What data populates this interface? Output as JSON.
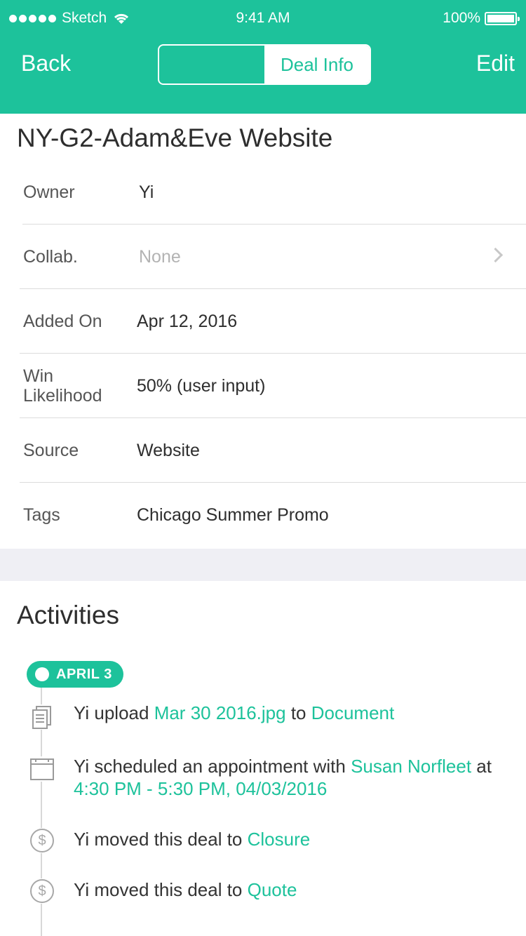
{
  "status_bar": {
    "carrier": "Sketch",
    "time": "9:41 AM",
    "battery": "100%"
  },
  "nav": {
    "back": "Back",
    "segments": [
      "",
      "Deal Info"
    ],
    "edit": "Edit"
  },
  "deal": {
    "title": "NY-G2-Adam&Eve Website",
    "rows": [
      {
        "label": "Owner",
        "value": "Yi"
      },
      {
        "label": "Collab.",
        "value": "None"
      },
      {
        "label": "Added On",
        "value": "Apr 12, 2016"
      },
      {
        "label_line1": "Win",
        "label_line2": "Likelihood",
        "value": "50% (user input)"
      },
      {
        "label": "Source",
        "value": "Website"
      },
      {
        "label": "Tags",
        "value": "Chicago Summer Promo"
      }
    ]
  },
  "activities": {
    "title": "Activities",
    "date_badge": "APRIL 3",
    "items": [
      {
        "icon": "document-icon",
        "parts": [
          "Yi upload ",
          "Mar 30 2016.jpg",
          " to ",
          "Document"
        ]
      },
      {
        "icon": "calendar-icon",
        "parts": [
          "Yi scheduled an appointment with ",
          "Susan Norfleet",
          " at ",
          "4:30 PM - 5:30 PM, 04/03/2016"
        ]
      },
      {
        "icon": "dollar-icon",
        "parts": [
          "Yi moved this deal to ",
          "Closure"
        ]
      },
      {
        "icon": "dollar-icon",
        "parts": [
          "Yi moved this deal to ",
          "Quote"
        ]
      }
    ]
  },
  "colors": {
    "accent": "#1dc29b",
    "background_gap": "#efeff4"
  }
}
